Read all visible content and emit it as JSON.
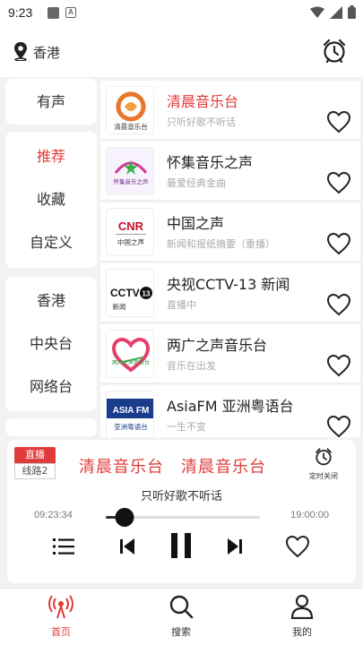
{
  "status_bar": {
    "time": "9:23",
    "notif_badge": "A"
  },
  "header": {
    "location": "香港",
    "location_icon": "map-pin-icon",
    "alarm_icon": "alarm-clock-icon"
  },
  "categories": {
    "group1": [
      "有声"
    ],
    "group2": [
      "推荐",
      "收藏",
      "自定义"
    ],
    "group3": [
      "香港",
      "中央台",
      "网络台"
    ],
    "active": "推荐"
  },
  "stations": [
    {
      "name": "清晨音乐台",
      "desc": "只听好歌不听话",
      "logo_text": "清晨音乐台",
      "active": true
    },
    {
      "name": "怀集音乐之声",
      "desc": "最爱经典金曲",
      "logo_text": "怀集音乐之声"
    },
    {
      "name": "中国之声",
      "desc": "新闻和报纸摘要（重播）",
      "logo_text": "CNR",
      "logo_sub": "中国之声"
    },
    {
      "name": "央视CCTV-13 新闻",
      "desc": "直播中",
      "logo_text": "CCTV",
      "logo_num": "13",
      "logo_sub": "新闻"
    },
    {
      "name": "两广之声音乐台",
      "desc": "音乐在出发",
      "logo_text": "两广之声音乐台"
    },
    {
      "name": "AsiaFM 亚洲粤语台",
      "desc": "一生不变",
      "logo_text": "ASIA FM",
      "logo_sub": "亚洲粤语台"
    }
  ],
  "player": {
    "live_label": "直播",
    "line_label": "线路2",
    "title": "清晨音乐台　清晨音乐台",
    "subtitle": "只听好歌不听话",
    "timer_label": "定时关闭",
    "current_time": "09:23:34",
    "end_time": "19:00:00",
    "progress": 0.12
  },
  "nav": [
    {
      "label": "首页",
      "icon": "radio-tower-icon",
      "active": true
    },
    {
      "label": "搜索",
      "icon": "search-icon"
    },
    {
      "label": "我的",
      "icon": "user-icon"
    }
  ],
  "colors": {
    "accent": "#e03b3b",
    "background": "#f2f2f2"
  }
}
